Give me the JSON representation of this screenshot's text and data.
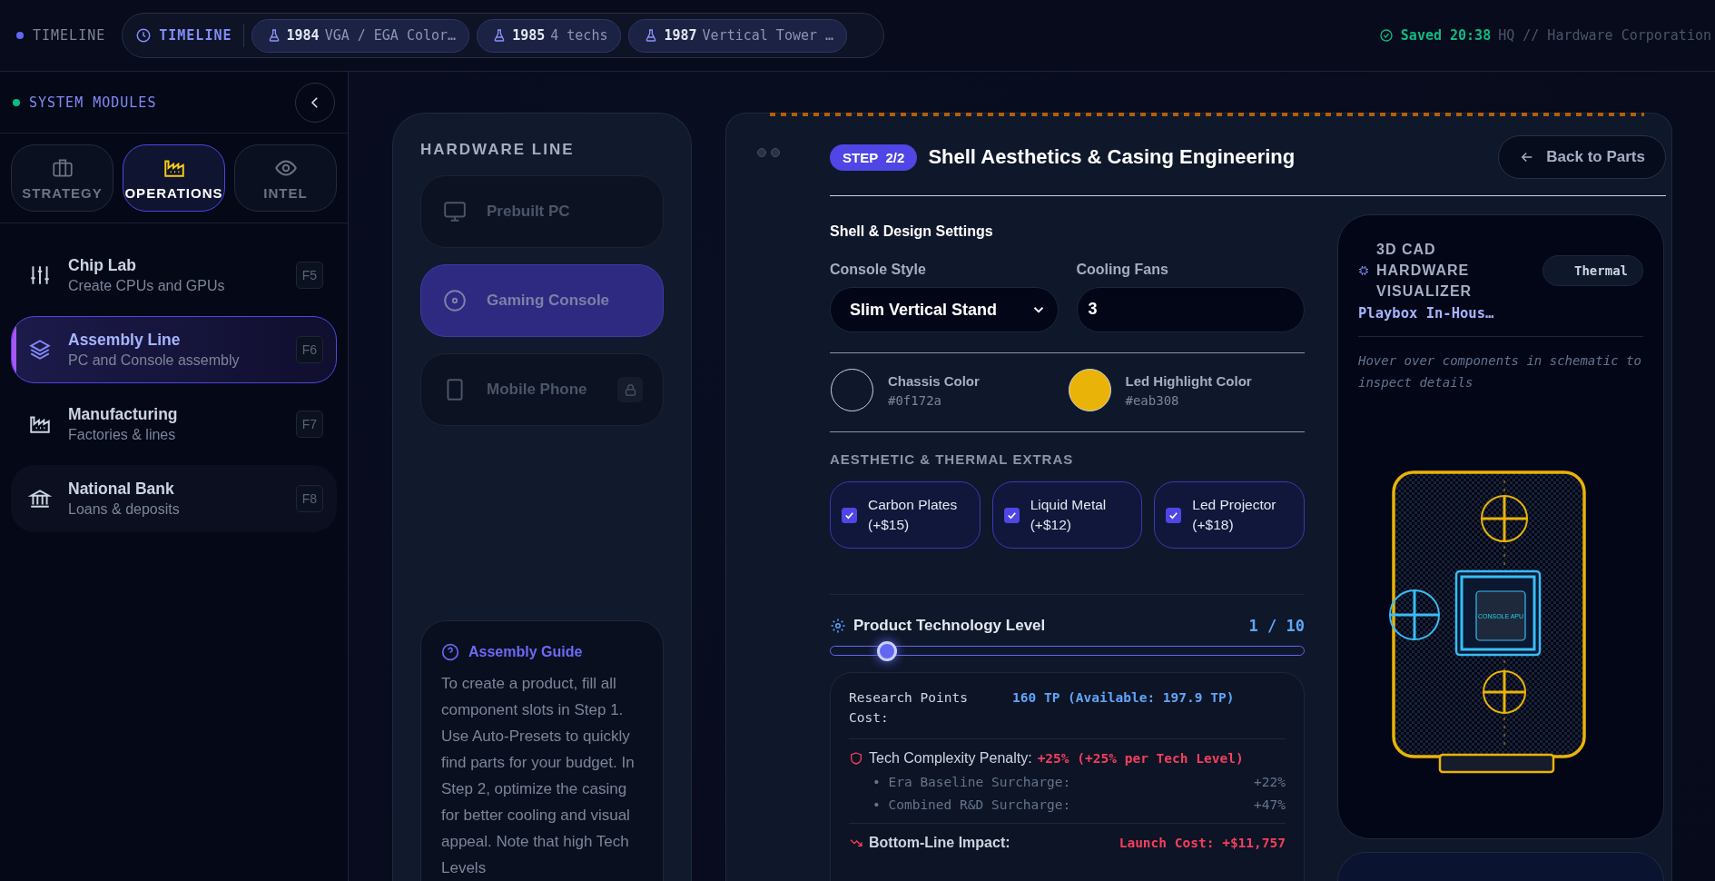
{
  "top_bar": {
    "label": "TIMELINE",
    "timeline_button": "TIMELINE",
    "milestones": [
      {
        "year": "1984",
        "text": "VGA / EGA Color…"
      },
      {
        "year": "1985",
        "text": "4 techs"
      },
      {
        "year": "1987",
        "text": "Vertical Tower …"
      }
    ],
    "save_status": "Saved 20:38",
    "company": "HQ // Hardware Corporation"
  },
  "sidebar": {
    "title": "SYSTEM MODULES",
    "tabs": [
      {
        "label": "STRATEGY",
        "kind": "briefcase",
        "selected": false
      },
      {
        "label": "OPERATIONS",
        "kind": "factory",
        "selected": true
      },
      {
        "label": "INTEL",
        "kind": "eye",
        "selected": false
      }
    ],
    "items": [
      {
        "title": "Chip Lab",
        "subtitle": "Create CPUs and GPUs",
        "shortcut": "F5",
        "kind": "sliders",
        "selected": false
      },
      {
        "title": "Assembly Line",
        "subtitle": "PC and Console assembly",
        "shortcut": "F6",
        "kind": "layers",
        "selected": true
      },
      {
        "title": "Manufacturing",
        "subtitle": "Factories & lines",
        "shortcut": "F7",
        "kind": "factory",
        "selected": false
      },
      {
        "title": "National Bank",
        "subtitle": "Loans & deposits",
        "shortcut": "F8",
        "kind": "bank",
        "selected": false
      }
    ]
  },
  "hardware_line": {
    "title": "HARDWARE LINE",
    "items": [
      {
        "label": "Prebuilt PC",
        "kind": "monitor",
        "selected": false,
        "locked": false
      },
      {
        "label": "Gaming Console",
        "kind": "disc",
        "selected": true,
        "locked": false
      },
      {
        "label": "Mobile Phone",
        "kind": "phone",
        "selected": false,
        "locked": true
      }
    ],
    "guide": {
      "title": "Assembly Guide",
      "text": "To create a product, fill all component slots in Step 1. Use Auto-Presets to quickly find parts for your budget. In Step 2, optimize the casing for better cooling and visual appeal. Note that high Tech Levels"
    }
  },
  "editor": {
    "step_label": "STEP",
    "step": "2/2",
    "title": "Shell Aesthetics & Casing Engineering",
    "back_button": "Back to Parts",
    "section": "Shell & Design Settings",
    "fields": [
      {
        "label": "Console Style",
        "kind": "select",
        "value": "Slim Vertical Stand"
      },
      {
        "label": "Cooling Fans",
        "kind": "input",
        "value": "3"
      }
    ],
    "colors": [
      {
        "label": "Chassis Color",
        "hex": "#0f172a",
        "color": "#0f172a"
      },
      {
        "label": "Led Highlight Color",
        "hex": "#eab308",
        "color": "#eab308"
      }
    ],
    "extras_title": "AESTHETIC & THERMAL EXTRAS",
    "extras": [
      {
        "label": "Carbon Plates (+$15)",
        "checked": true
      },
      {
        "label": "Liquid Metal (+$12)",
        "checked": true
      },
      {
        "label": "Led Projector (+$18)",
        "checked": true
      }
    ],
    "tech_level": {
      "label": "Product Technology Level",
      "reading": "1 / 10",
      "level": 0.12
    },
    "costs": {
      "research_label": "Research Points Cost:",
      "research_value": "160 TP (Available: 197.9 TP)",
      "penalty_label": "Tech Complexity Penalty:",
      "penalty_value": "+25% (+25% per Tech Level)",
      "surcharges": [
        {
          "label": "• Era Baseline Surcharge:",
          "value": "+22%"
        },
        {
          "label": "• Combined R&D Surcharge:",
          "value": "+47%"
        }
      ],
      "impact_label": "Bottom-Line Impact:",
      "impact_value": "Launch Cost: +$11,757"
    }
  },
  "visualizer": {
    "title": "3D CAD HARDWARE VISUALIZER",
    "mode": "Thermal",
    "product": "Playbox In-Hous…",
    "hint": "Hover over components in schematic to inspect details",
    "chip_label": "CONSOLE APU"
  }
}
